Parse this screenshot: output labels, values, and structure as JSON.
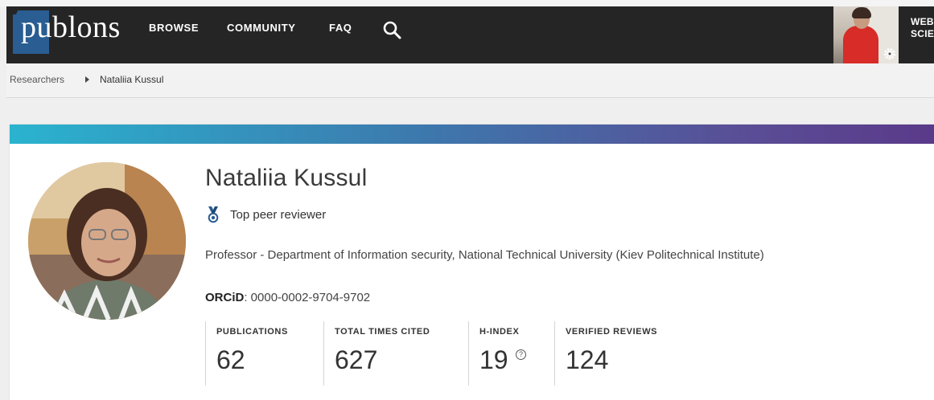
{
  "navbar": {
    "logo": "publons",
    "links": [
      "BROWSE",
      "COMMUNITY",
      "FAQ"
    ],
    "search_icon": "search-icon",
    "web_of_science": "WEB\nSCIE"
  },
  "breadcrumb": {
    "items": [
      "Researchers",
      "Nataliia Kussul"
    ]
  },
  "profile": {
    "name": "Nataliia Kussul",
    "badge": "Top peer reviewer",
    "position": "Professor - Department of Information security, National Technical University (Kiev Politechnical Institute)",
    "orcid_label": "ORCiD",
    "orcid_value": ": 0000-0002-9704-9702",
    "stats": [
      {
        "label": "PUBLICATIONS",
        "value": "62"
      },
      {
        "label": "TOTAL TIMES CITED",
        "value": "627"
      },
      {
        "label": "H-INDEX",
        "value": "19"
      },
      {
        "label": "VERIFIED REVIEWS",
        "value": "124"
      }
    ]
  },
  "colors": {
    "navbar": "#252525",
    "logo_mark": "#2a5d91",
    "gradient_start": "#2ab3cf",
    "gradient_end": "#5a3a8a",
    "medal": "#2a5d91"
  }
}
